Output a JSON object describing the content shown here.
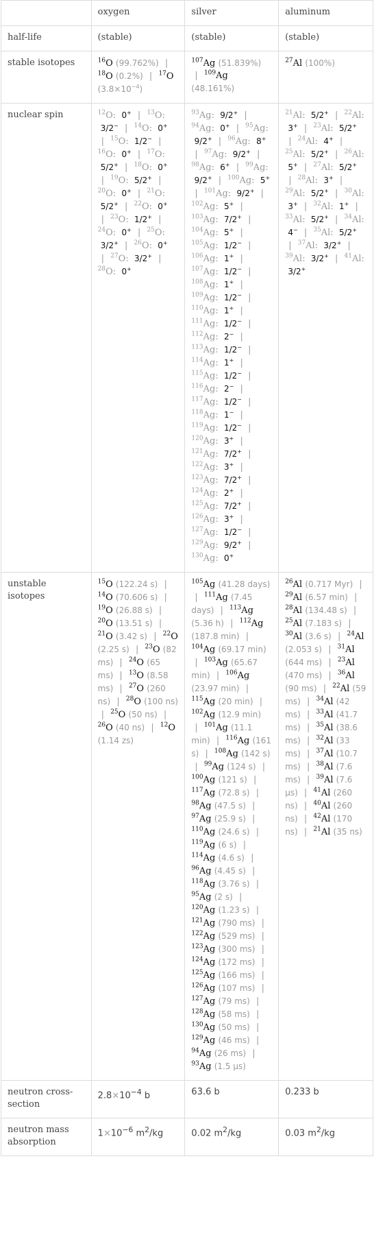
{
  "columns": [
    "",
    "oxygen",
    "silver",
    "aluminum"
  ],
  "rows": {
    "half_life": {
      "label": "half-life",
      "values": [
        "(stable)",
        "(stable)",
        "(stable)"
      ]
    },
    "stable_isotopes": {
      "label": "stable isotopes",
      "oxygen": [
        {
          "mass": "16",
          "symbol": "O",
          "abundance": "(99.762%)"
        },
        {
          "mass": "18",
          "symbol": "O",
          "abundance": "(0.2%)"
        },
        {
          "mass": "17",
          "symbol": "O",
          "abundance": "(3.8×10",
          "abundance_exp": "−4",
          "abundance_tail": ")"
        }
      ],
      "silver": [
        {
          "mass": "107",
          "symbol": "Ag",
          "abundance": "(51.839%)"
        },
        {
          "mass": "109",
          "symbol": "Ag",
          "abundance": "(48.161%)"
        }
      ],
      "aluminum": [
        {
          "mass": "27",
          "symbol": "Al",
          "abundance": "(100%)"
        }
      ]
    },
    "nuclear_spin": {
      "label": "nuclear spin",
      "oxygen": [
        {
          "mass": "12",
          "symbol": "O",
          "spin": "0",
          "parity": "+"
        },
        {
          "mass": "13",
          "symbol": "O",
          "spin": "3/2",
          "parity": "−"
        },
        {
          "mass": "14",
          "symbol": "O",
          "spin": "0",
          "parity": "+"
        },
        {
          "mass": "15",
          "symbol": "O",
          "spin": "1/2",
          "parity": "−"
        },
        {
          "mass": "16",
          "symbol": "O",
          "spin": "0",
          "parity": "+"
        },
        {
          "mass": "17",
          "symbol": "O",
          "spin": "5/2",
          "parity": "+"
        },
        {
          "mass": "18",
          "symbol": "O",
          "spin": "0",
          "parity": "+"
        },
        {
          "mass": "19",
          "symbol": "O",
          "spin": "5/2",
          "parity": "+"
        },
        {
          "mass": "20",
          "symbol": "O",
          "spin": "0",
          "parity": "+"
        },
        {
          "mass": "21",
          "symbol": "O",
          "spin": "5/2",
          "parity": "+"
        },
        {
          "mass": "22",
          "symbol": "O",
          "spin": "0",
          "parity": "+"
        },
        {
          "mass": "23",
          "symbol": "O",
          "spin": "1/2",
          "parity": "+"
        },
        {
          "mass": "24",
          "symbol": "O",
          "spin": "0",
          "parity": "+"
        },
        {
          "mass": "25",
          "symbol": "O",
          "spin": "3/2",
          "parity": "+"
        },
        {
          "mass": "26",
          "symbol": "O",
          "spin": "0",
          "parity": "+"
        },
        {
          "mass": "27",
          "symbol": "O",
          "spin": "3/2",
          "parity": "+"
        },
        {
          "mass": "28",
          "symbol": "O",
          "spin": "0",
          "parity": "+"
        }
      ],
      "silver": [
        {
          "mass": "93",
          "symbol": "Ag",
          "spin": "9/2",
          "parity": "+"
        },
        {
          "mass": "94",
          "symbol": "Ag",
          "spin": "0",
          "parity": "+"
        },
        {
          "mass": "95",
          "symbol": "Ag",
          "spin": "9/2",
          "parity": "+"
        },
        {
          "mass": "96",
          "symbol": "Ag",
          "spin": "8",
          "parity": "+"
        },
        {
          "mass": "97",
          "symbol": "Ag",
          "spin": "9/2",
          "parity": "+"
        },
        {
          "mass": "98",
          "symbol": "Ag",
          "spin": "6",
          "parity": "+"
        },
        {
          "mass": "99",
          "symbol": "Ag",
          "spin": "9/2",
          "parity": "+"
        },
        {
          "mass": "100",
          "symbol": "Ag",
          "spin": "5",
          "parity": "+"
        },
        {
          "mass": "101",
          "symbol": "Ag",
          "spin": "9/2",
          "parity": "+"
        },
        {
          "mass": "102",
          "symbol": "Ag",
          "spin": "5",
          "parity": "+"
        },
        {
          "mass": "103",
          "symbol": "Ag",
          "spin": "7/2",
          "parity": "+"
        },
        {
          "mass": "104",
          "symbol": "Ag",
          "spin": "5",
          "parity": "+"
        },
        {
          "mass": "105",
          "symbol": "Ag",
          "spin": "1/2",
          "parity": "−"
        },
        {
          "mass": "106",
          "symbol": "Ag",
          "spin": "1",
          "parity": "+"
        },
        {
          "mass": "107",
          "symbol": "Ag",
          "spin": "1/2",
          "parity": "−"
        },
        {
          "mass": "108",
          "symbol": "Ag",
          "spin": "1",
          "parity": "+"
        },
        {
          "mass": "109",
          "symbol": "Ag",
          "spin": "1/2",
          "parity": "−"
        },
        {
          "mass": "110",
          "symbol": "Ag",
          "spin": "1",
          "parity": "+"
        },
        {
          "mass": "111",
          "symbol": "Ag",
          "spin": "1/2",
          "parity": "−"
        },
        {
          "mass": "112",
          "symbol": "Ag",
          "spin": "2",
          "parity": "−"
        },
        {
          "mass": "113",
          "symbol": "Ag",
          "spin": "1/2",
          "parity": "−"
        },
        {
          "mass": "114",
          "symbol": "Ag",
          "spin": "1",
          "parity": "+"
        },
        {
          "mass": "115",
          "symbol": "Ag",
          "spin": "1/2",
          "parity": "−"
        },
        {
          "mass": "116",
          "symbol": "Ag",
          "spin": "2",
          "parity": "−"
        },
        {
          "mass": "117",
          "symbol": "Ag",
          "spin": "1/2",
          "parity": "−"
        },
        {
          "mass": "118",
          "symbol": "Ag",
          "spin": "1",
          "parity": "−"
        },
        {
          "mass": "119",
          "symbol": "Ag",
          "spin": "1/2",
          "parity": "−"
        },
        {
          "mass": "120",
          "symbol": "Ag",
          "spin": "3",
          "parity": "+"
        },
        {
          "mass": "121",
          "symbol": "Ag",
          "spin": "7/2",
          "parity": "+"
        },
        {
          "mass": "122",
          "symbol": "Ag",
          "spin": "3",
          "parity": "+"
        },
        {
          "mass": "123",
          "symbol": "Ag",
          "spin": "7/2",
          "parity": "+"
        },
        {
          "mass": "124",
          "symbol": "Ag",
          "spin": "2",
          "parity": "+"
        },
        {
          "mass": "125",
          "symbol": "Ag",
          "spin": "7/2",
          "parity": "+"
        },
        {
          "mass": "126",
          "symbol": "Ag",
          "spin": "3",
          "parity": "+"
        },
        {
          "mass": "127",
          "symbol": "Ag",
          "spin": "1/2",
          "parity": "−"
        },
        {
          "mass": "129",
          "symbol": "Ag",
          "spin": "9/2",
          "parity": "+"
        },
        {
          "mass": "130",
          "symbol": "Ag",
          "spin": "0",
          "parity": "+"
        }
      ],
      "aluminum": [
        {
          "mass": "21",
          "symbol": "Al",
          "spin": "5/2",
          "parity": "+"
        },
        {
          "mass": "22",
          "symbol": "Al",
          "spin": "3",
          "parity": "+"
        },
        {
          "mass": "23",
          "symbol": "Al",
          "spin": "5/2",
          "parity": "+"
        },
        {
          "mass": "24",
          "symbol": "Al",
          "spin": "4",
          "parity": "+"
        },
        {
          "mass": "25",
          "symbol": "Al",
          "spin": "5/2",
          "parity": "+"
        },
        {
          "mass": "26",
          "symbol": "Al",
          "spin": "5",
          "parity": "+"
        },
        {
          "mass": "27",
          "symbol": "Al",
          "spin": "5/2",
          "parity": "+"
        },
        {
          "mass": "28",
          "symbol": "Al",
          "spin": "3",
          "parity": "+"
        },
        {
          "mass": "29",
          "symbol": "Al",
          "spin": "5/2",
          "parity": "+"
        },
        {
          "mass": "30",
          "symbol": "Al",
          "spin": "3",
          "parity": "+"
        },
        {
          "mass": "32",
          "symbol": "Al",
          "spin": "1",
          "parity": "+"
        },
        {
          "mass": "33",
          "symbol": "Al",
          "spin": "5/2",
          "parity": "+"
        },
        {
          "mass": "34",
          "symbol": "Al",
          "spin": "4",
          "parity": "−"
        },
        {
          "mass": "35",
          "symbol": "Al",
          "spin": "5/2",
          "parity": "+"
        },
        {
          "mass": "37",
          "symbol": "Al",
          "spin": "3/2",
          "parity": "+"
        },
        {
          "mass": "39",
          "symbol": "Al",
          "spin": "3/2",
          "parity": "+"
        },
        {
          "mass": "41",
          "symbol": "Al",
          "spin": "3/2",
          "parity": "+"
        }
      ]
    },
    "unstable_isotopes": {
      "label": "unstable isotopes",
      "oxygen": [
        {
          "mass": "15",
          "symbol": "O",
          "half_life": "(122.24 s)"
        },
        {
          "mass": "14",
          "symbol": "O",
          "half_life": "(70.606 s)"
        },
        {
          "mass": "19",
          "symbol": "O",
          "half_life": "(26.88 s)"
        },
        {
          "mass": "20",
          "symbol": "O",
          "half_life": "(13.51 s)"
        },
        {
          "mass": "21",
          "symbol": "O",
          "half_life": "(3.42 s)"
        },
        {
          "mass": "22",
          "symbol": "O",
          "half_life": "(2.25 s)"
        },
        {
          "mass": "23",
          "symbol": "O",
          "half_life": "(82 ms)"
        },
        {
          "mass": "24",
          "symbol": "O",
          "half_life": "(65 ms)"
        },
        {
          "mass": "13",
          "symbol": "O",
          "half_life": "(8.58 ms)"
        },
        {
          "mass": "27",
          "symbol": "O",
          "half_life": "(260 ns)"
        },
        {
          "mass": "28",
          "symbol": "O",
          "half_life": "(100 ns)"
        },
        {
          "mass": "25",
          "symbol": "O",
          "half_life": "(50 ns)"
        },
        {
          "mass": "26",
          "symbol": "O",
          "half_life": "(40 ns)"
        },
        {
          "mass": "12",
          "symbol": "O",
          "half_life": "(1.14 zs)"
        }
      ],
      "silver": [
        {
          "mass": "105",
          "symbol": "Ag",
          "half_life": "(41.28 days)"
        },
        {
          "mass": "111",
          "symbol": "Ag",
          "half_life": "(7.45 days)"
        },
        {
          "mass": "113",
          "symbol": "Ag",
          "half_life": "(5.36 h)"
        },
        {
          "mass": "112",
          "symbol": "Ag",
          "half_life": "(187.8 min)"
        },
        {
          "mass": "104",
          "symbol": "Ag",
          "half_life": "(69.17 min)"
        },
        {
          "mass": "103",
          "symbol": "Ag",
          "half_life": "(65.67 min)"
        },
        {
          "mass": "106",
          "symbol": "Ag",
          "half_life": "(23.97 min)"
        },
        {
          "mass": "115",
          "symbol": "Ag",
          "half_life": "(20 min)"
        },
        {
          "mass": "102",
          "symbol": "Ag",
          "half_life": "(12.9 min)"
        },
        {
          "mass": "101",
          "symbol": "Ag",
          "half_life": "(11.1 min)"
        },
        {
          "mass": "116",
          "symbol": "Ag",
          "half_life": "(161 s)"
        },
        {
          "mass": "108",
          "symbol": "Ag",
          "half_life": "(142 s)"
        },
        {
          "mass": "99",
          "symbol": "Ag",
          "half_life": "(124 s)"
        },
        {
          "mass": "100",
          "symbol": "Ag",
          "half_life": "(121 s)"
        },
        {
          "mass": "117",
          "symbol": "Ag",
          "half_life": "(72.8 s)"
        },
        {
          "mass": "98",
          "symbol": "Ag",
          "half_life": "(47.5 s)"
        },
        {
          "mass": "97",
          "symbol": "Ag",
          "half_life": "(25.9 s)"
        },
        {
          "mass": "110",
          "symbol": "Ag",
          "half_life": "(24.6 s)"
        },
        {
          "mass": "119",
          "symbol": "Ag",
          "half_life": "(6 s)"
        },
        {
          "mass": "114",
          "symbol": "Ag",
          "half_life": "(4.6 s)"
        },
        {
          "mass": "96",
          "symbol": "Ag",
          "half_life": "(4.45 s)"
        },
        {
          "mass": "118",
          "symbol": "Ag",
          "half_life": "(3.76 s)"
        },
        {
          "mass": "95",
          "symbol": "Ag",
          "half_life": "(2 s)"
        },
        {
          "mass": "120",
          "symbol": "Ag",
          "half_life": "(1.23 s)"
        },
        {
          "mass": "121",
          "symbol": "Ag",
          "half_life": "(790 ms)"
        },
        {
          "mass": "122",
          "symbol": "Ag",
          "half_life": "(529 ms)"
        },
        {
          "mass": "123",
          "symbol": "Ag",
          "half_life": "(300 ms)"
        },
        {
          "mass": "124",
          "symbol": "Ag",
          "half_life": "(172 ms)"
        },
        {
          "mass": "125",
          "symbol": "Ag",
          "half_life": "(166 ms)"
        },
        {
          "mass": "126",
          "symbol": "Ag",
          "half_life": "(107 ms)"
        },
        {
          "mass": "127",
          "symbol": "Ag",
          "half_life": "(79 ms)"
        },
        {
          "mass": "128",
          "symbol": "Ag",
          "half_life": "(58 ms)"
        },
        {
          "mass": "130",
          "symbol": "Ag",
          "half_life": "(50 ms)"
        },
        {
          "mass": "129",
          "symbol": "Ag",
          "half_life": "(46 ms)"
        },
        {
          "mass": "94",
          "symbol": "Ag",
          "half_life": "(26 ms)"
        },
        {
          "mass": "93",
          "symbol": "Ag",
          "half_life": "(1.5 μs)"
        }
      ],
      "aluminum": [
        {
          "mass": "26",
          "symbol": "Al",
          "half_life": "(0.717 Myr)"
        },
        {
          "mass": "29",
          "symbol": "Al",
          "half_life": "(6.57 min)"
        },
        {
          "mass": "28",
          "symbol": "Al",
          "half_life": "(134.48 s)"
        },
        {
          "mass": "25",
          "symbol": "Al",
          "half_life": "(7.183 s)"
        },
        {
          "mass": "30",
          "symbol": "Al",
          "half_life": "(3.6 s)"
        },
        {
          "mass": "24",
          "symbol": "Al",
          "half_life": "(2.053 s)"
        },
        {
          "mass": "31",
          "symbol": "Al",
          "half_life": "(644 ms)"
        },
        {
          "mass": "23",
          "symbol": "Al",
          "half_life": "(470 ms)"
        },
        {
          "mass": "36",
          "symbol": "Al",
          "half_life": "(90 ms)"
        },
        {
          "mass": "22",
          "symbol": "Al",
          "half_life": "(59 ms)"
        },
        {
          "mass": "34",
          "symbol": "Al",
          "half_life": "(42 ms)"
        },
        {
          "mass": "33",
          "symbol": "Al",
          "half_life": "(41.7 ms)"
        },
        {
          "mass": "35",
          "symbol": "Al",
          "half_life": "(38.6 ms)"
        },
        {
          "mass": "32",
          "symbol": "Al",
          "half_life": "(33 ms)"
        },
        {
          "mass": "37",
          "symbol": "Al",
          "half_life": "(10.7 ms)"
        },
        {
          "mass": "38",
          "symbol": "Al",
          "half_life": "(7.6 ms)"
        },
        {
          "mass": "39",
          "symbol": "Al",
          "half_life": "(7.6 μs)"
        },
        {
          "mass": "41",
          "symbol": "Al",
          "half_life": "(260 ns)"
        },
        {
          "mass": "40",
          "symbol": "Al",
          "half_life": "(260 ns)"
        },
        {
          "mass": "42",
          "symbol": "Al",
          "half_life": "(170 ns)"
        },
        {
          "mass": "21",
          "symbol": "Al",
          "half_life": "(35 ns)"
        }
      ]
    },
    "neutron_cross_section": {
      "label": "neutron cross-section",
      "oxygen": {
        "mantissa": "2.8",
        "times": "×",
        "base": "10",
        "exp": "−4",
        "unit": " b"
      },
      "silver": "63.6 b",
      "aluminum": "0.233 b"
    },
    "neutron_mass_absorption": {
      "label": "neutron mass absorption",
      "oxygen": {
        "mantissa": "1",
        "times": "×",
        "base": "10",
        "exp": "−6",
        "unit_pre": " m",
        "unit_exp": "2",
        "unit_post": "/kg"
      },
      "silver": {
        "value": "0.02 m",
        "unit_exp": "2",
        "unit_post": "/kg"
      },
      "aluminum": {
        "value": "0.03 m",
        "unit_exp": "2",
        "unit_post": "/kg"
      }
    }
  },
  "separator": "|"
}
